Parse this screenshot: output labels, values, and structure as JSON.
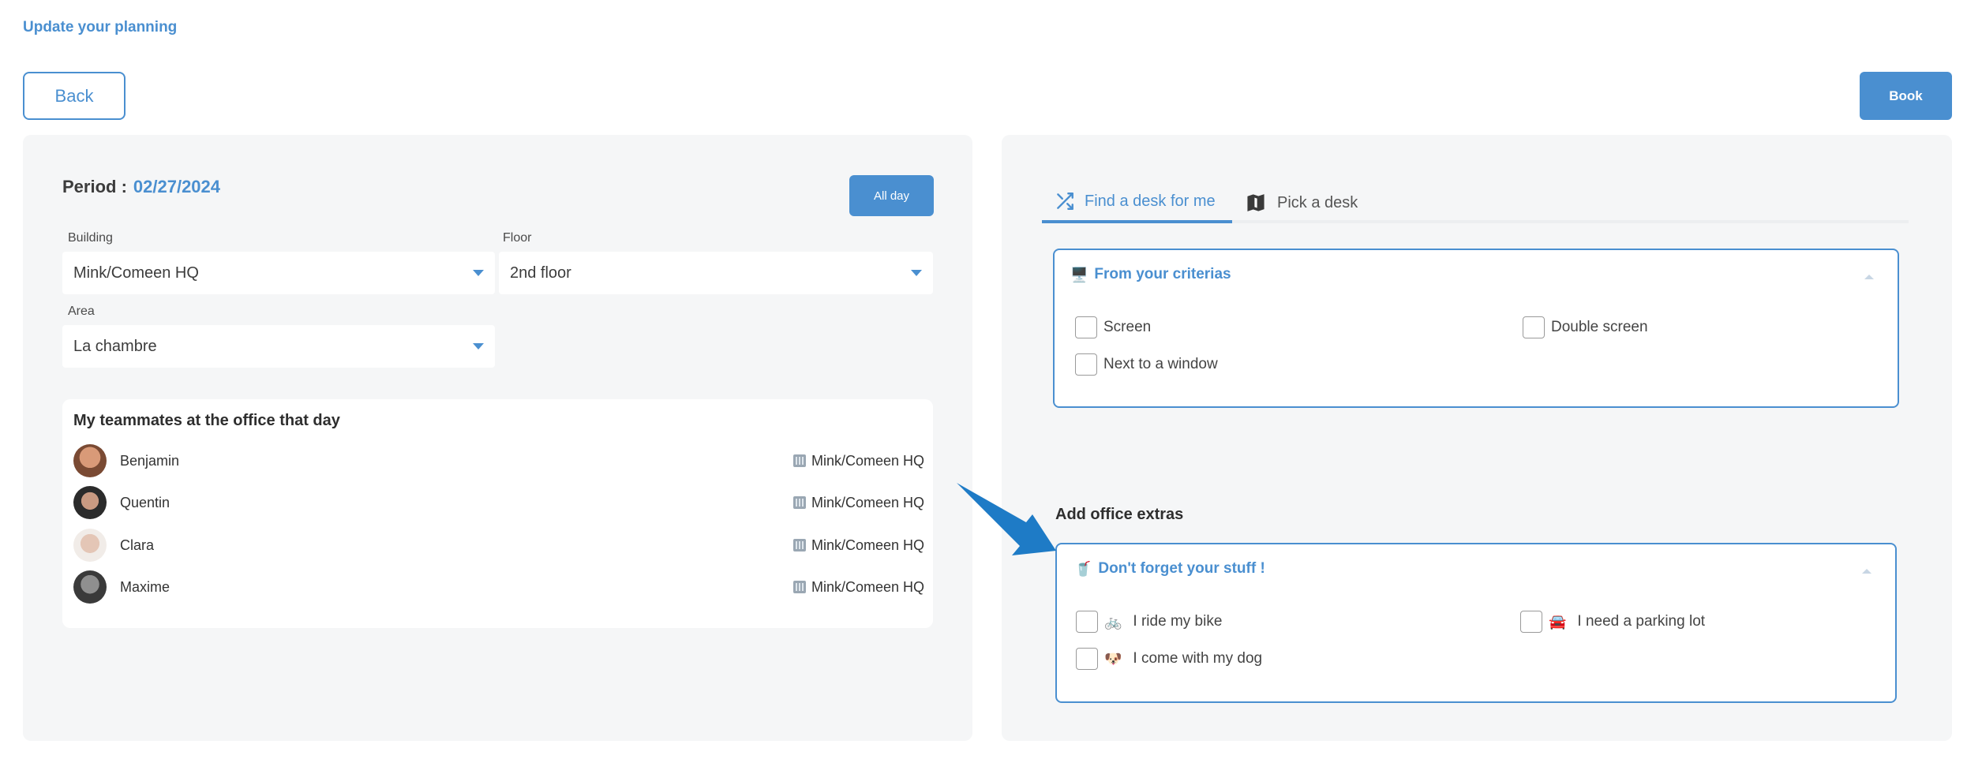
{
  "header": {
    "title": "Update your planning"
  },
  "actions": {
    "back_label": "Back",
    "book_label": "Book"
  },
  "left": {
    "period_label": "Period :",
    "period_date": "02/27/2024",
    "allday_label": "All day",
    "building": {
      "label": "Building",
      "value": "Mink/Comeen HQ"
    },
    "floor": {
      "label": "Floor",
      "value": "2nd floor"
    },
    "area": {
      "label": "Area",
      "value": "La chambre"
    },
    "teammates": {
      "title": "My teammates at the office that day",
      "items": [
        {
          "name": "Benjamin",
          "location": "Mink/Comeen HQ"
        },
        {
          "name": "Quentin",
          "location": "Mink/Comeen HQ"
        },
        {
          "name": "Clara",
          "location": "Mink/Comeen HQ"
        },
        {
          "name": "Maxime",
          "location": "Mink/Comeen HQ"
        }
      ]
    }
  },
  "right": {
    "tabs": [
      {
        "label": "Find a desk for me",
        "icon": "shuffle-icon",
        "active": true
      },
      {
        "label": "Pick a desk",
        "icon": "map-icon",
        "active": false
      }
    ],
    "criteria": {
      "emoji": "🖥️",
      "title": "From your criterias",
      "options": [
        "Screen",
        "Double screen",
        "Next to a window"
      ]
    },
    "extras_title": "Add office extras",
    "stuff": {
      "emoji": "🥤",
      "title": "Don't forget your stuff !",
      "options": [
        {
          "emoji": "🚲",
          "label": "I ride my bike"
        },
        {
          "emoji": "🚘",
          "label": "I need a parking lot"
        },
        {
          "emoji": "🐶",
          "label": "I come with my dog"
        }
      ]
    }
  },
  "colors": {
    "accent": "#4a8fd0",
    "panel_bg": "#f5f6f7",
    "arrow": "#1e7bc6"
  }
}
